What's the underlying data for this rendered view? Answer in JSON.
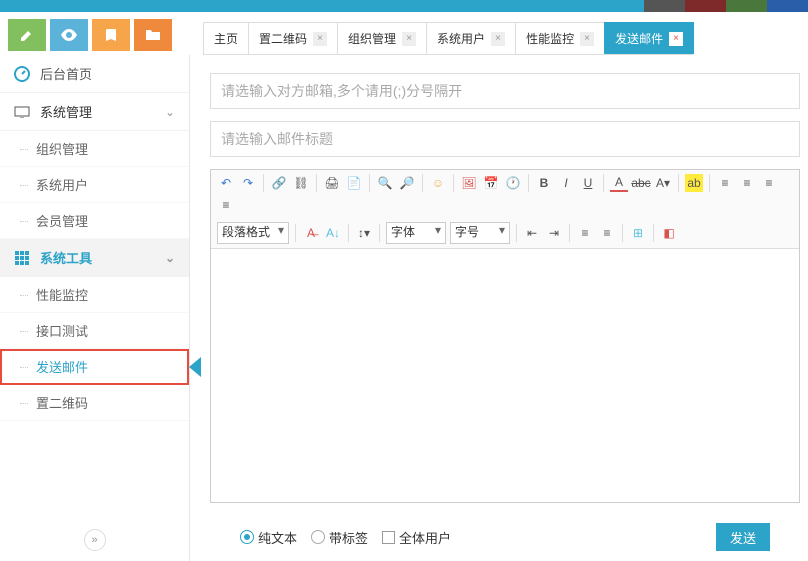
{
  "swatches": [
    "#555555",
    "#7f2a2a",
    "#4a773c",
    "#2a5ea8"
  ],
  "action_buttons": [
    "edit-icon",
    "eye-icon",
    "book-icon",
    "folder-icon"
  ],
  "tabs": [
    {
      "label": "主页",
      "closable": false
    },
    {
      "label": "置二维码",
      "closable": true
    },
    {
      "label": "组织管理",
      "closable": true
    },
    {
      "label": "系统用户",
      "closable": true
    },
    {
      "label": "性能监控",
      "closable": true
    },
    {
      "label": "发送邮件",
      "closable": true,
      "active": true
    }
  ],
  "sidebar": {
    "home": "后台首页",
    "group1": {
      "label": "系统管理",
      "items": [
        "组织管理",
        "系统用户",
        "会员管理"
      ]
    },
    "group2": {
      "label": "系统工具",
      "items": [
        "性能监控",
        "接口测试",
        "发送邮件",
        "置二维码"
      ],
      "active_item": "发送邮件"
    }
  },
  "form": {
    "recipients_placeholder": "请选输入对方邮箱,多个请用(;)分号隔开",
    "subject_placeholder": "请选输入邮件标题",
    "radio_plain": "纯文本",
    "radio_tag": "带标签",
    "checkbox_all": "全体用户",
    "send": "发送"
  },
  "editor": {
    "format_select": "段落格式",
    "font_family_select": "字体",
    "font_size_select": "字号"
  }
}
